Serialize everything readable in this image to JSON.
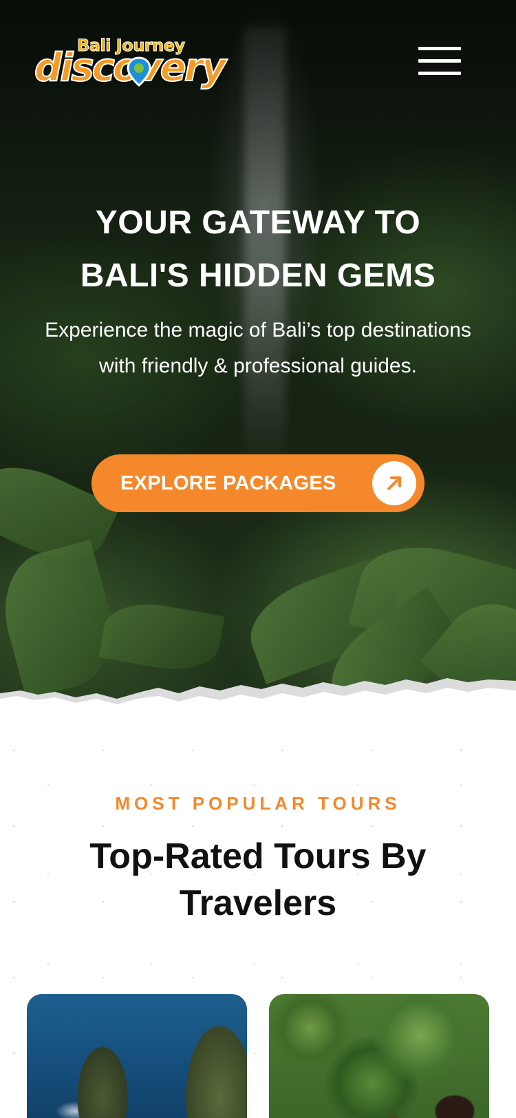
{
  "header": {
    "logo_top_text": "Bali Journey",
    "logo_main_text": "discovery",
    "menu_icon": "hamburger-menu-icon"
  },
  "hero": {
    "title_line1": "YOUR GATEWAY TO",
    "title_line2": "BALI'S HIDDEN GEMS",
    "subtitle": "Experience the magic of Bali’s top destinations with friendly & professional guides.",
    "cta_label": "EXPLORE PACKAGES",
    "cta_icon": "arrow-up-right-icon"
  },
  "popular": {
    "eyebrow": "MOST POPULAR TOURS",
    "title_light": "Top-Rated ",
    "title_bold": "Tours By Travelers"
  },
  "colors": {
    "accent": "#f5882a",
    "logo_yellow": "#f7b200",
    "text_dark": "#111111"
  }
}
